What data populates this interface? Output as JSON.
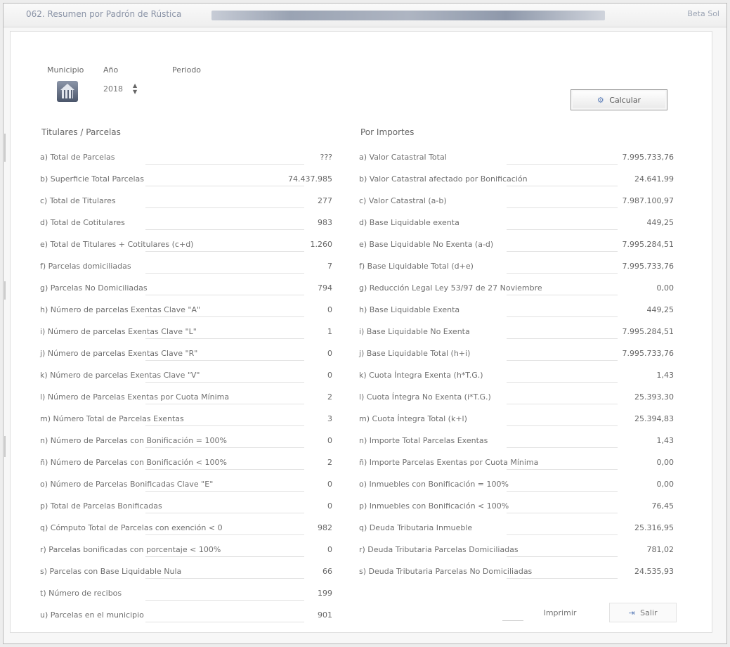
{
  "window": {
    "title": "062. Resumen por Padrón de Rústica",
    "controls": "Beta Sol"
  },
  "header": {
    "municipio_label": "Municipio",
    "anio_label": "Año",
    "periodo_label": "Periodo",
    "year_value": "2018",
    "calc_button": "Calcular"
  },
  "left": {
    "title": "Titulares / Parcelas",
    "rows": [
      {
        "label": "a) Total de Parcelas",
        "value": "???"
      },
      {
        "label": "b) Superficie Total Parcelas",
        "value": "74.437.985"
      },
      {
        "label": "c) Total de Titulares",
        "value": "277"
      },
      {
        "label": "d) Total de Cotitulares",
        "value": "983"
      },
      {
        "label": "e) Total de Titulares + Cotitulares (c+d)",
        "value": "1.260"
      },
      {
        "label": "f) Parcelas domiciliadas",
        "value": "7"
      },
      {
        "label": "g) Parcelas No Domiciliadas",
        "value": "794"
      },
      {
        "label": "h) Número de parcelas Exentas Clave \"A\"",
        "value": "0"
      },
      {
        "label": "i) Número de parcelas Exentas Clave \"L\"",
        "value": "1"
      },
      {
        "label": "j) Número de parcelas Exentas Clave \"R\"",
        "value": "0"
      },
      {
        "label": "k) Número de parcelas Exentas Clave \"V\"",
        "value": "0"
      },
      {
        "label": "l) Número de Parcelas Exentas por Cuota Mínima",
        "value": "2"
      },
      {
        "label": "m) Número Total de Parcelas Exentas",
        "value": "3"
      },
      {
        "label": "n) Número de Parcelas con Bonificación = 100%",
        "value": "0"
      },
      {
        "label": "ñ) Número de Parcelas con Bonificación < 100%",
        "value": "2"
      },
      {
        "label": "o) Número de Parcelas Bonificadas Clave \"E\"",
        "value": "0"
      },
      {
        "label": "p) Total de Parcelas Bonificadas",
        "value": "0"
      },
      {
        "label": "q) Cómputo Total de Parcelas con exención < 0",
        "value": "982"
      },
      {
        "label": "r) Parcelas bonificadas con porcentaje < 100%",
        "value": "0"
      },
      {
        "label": "s) Parcelas con Base Liquidable Nula",
        "value": "66"
      },
      {
        "label": "t) Número de recibos",
        "value": "199"
      },
      {
        "label": "u) Parcelas en el municipio",
        "value": "901"
      }
    ]
  },
  "right": {
    "title": "Por Importes",
    "rows": [
      {
        "label": "a) Valor Catastral Total",
        "value": "7.995.733,76"
      },
      {
        "label": "b) Valor Catastral afectado por Bonificación",
        "value": "24.641,99"
      },
      {
        "label": "c) Valor Catastral (a-b)",
        "value": "7.987.100,97"
      },
      {
        "label": "d) Base Liquidable exenta",
        "value": "449,25"
      },
      {
        "label": "e) Base Liquidable No Exenta (a-d)",
        "value": "7.995.284,51"
      },
      {
        "label": "f) Base Liquidable Total (d+e)",
        "value": "7.995.733,76"
      },
      {
        "label": "g) Reducción Legal Ley 53/97 de 27 Noviembre",
        "value": "0,00"
      },
      {
        "label": "h) Base Liquidable Exenta",
        "value": "449,25"
      },
      {
        "label": "i) Base Liquidable No Exenta",
        "value": "7.995.284,51"
      },
      {
        "label": "j) Base Liquidable Total (h+i)",
        "value": "7.995.733,76"
      },
      {
        "label": "k) Cuota Íntegra Exenta (h*T.G.)",
        "value": "1,43"
      },
      {
        "label": "l) Cuota Íntegra No Exenta (i*T.G.)",
        "value": "25.393,30"
      },
      {
        "label": "m) Cuota Íntegra Total (k+l)",
        "value": "25.394,83"
      },
      {
        "label": "n) Importe Total Parcelas Exentas",
        "value": "1,43"
      },
      {
        "label": "ñ) Importe Parcelas Exentas por Cuota Mínima",
        "value": "0,00"
      },
      {
        "label": "o) Inmuebles con Bonificación = 100%",
        "value": "0,00"
      },
      {
        "label": "p) Inmuebles con Bonificación < 100%",
        "value": "76,45"
      },
      {
        "label": "q) Deuda Tributaria Inmueble",
        "value": "25.316,95"
      },
      {
        "label": "r) Deuda Tributaria Parcelas Domiciliadas",
        "value": "781,02"
      },
      {
        "label": "s) Deuda Tributaria Parcelas No Domiciliadas",
        "value": "24.535,93"
      }
    ]
  },
  "footer": {
    "print_label": "Imprimir",
    "exit_label": "Salir"
  }
}
